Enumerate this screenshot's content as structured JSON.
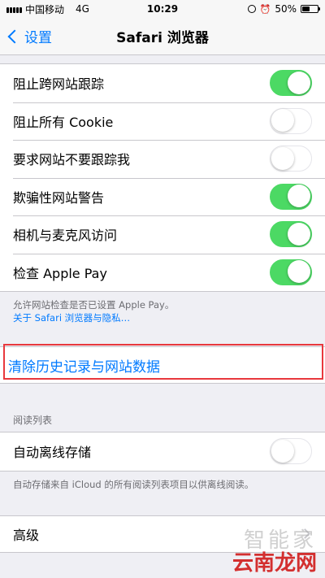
{
  "status_bar": {
    "carrier": "中国移动",
    "network": "4G",
    "time": "10:29",
    "battery_percent_label": "50%",
    "battery_level": 0.5
  },
  "nav": {
    "back_label": "设置",
    "title": "Safari 浏览器"
  },
  "privacy": {
    "rows": [
      {
        "label": "阻止跨网站跟踪",
        "on": true
      },
      {
        "label": "阻止所有 Cookie",
        "on": false
      },
      {
        "label": "要求网站不要跟踪我",
        "on": false
      },
      {
        "label": "欺骗性网站警告",
        "on": true
      },
      {
        "label": "相机与麦克风访问",
        "on": true
      },
      {
        "label": "检查 Apple Pay",
        "on": true
      }
    ],
    "footer_text": "允许网站检查是否已设置 Apple Pay。",
    "footer_link": "关于 Safari 浏览器与隐私…"
  },
  "clear_history": {
    "label": "清除历史记录与网站数据"
  },
  "reading_list": {
    "header": "阅读列表",
    "row": {
      "label": "自动离线存储",
      "on": false
    },
    "footer_text": "自动存储来自 iCloud 的所有阅读列表项目以供离线阅读。"
  },
  "advanced": {
    "label": "高级"
  },
  "watermark": {
    "top": "智能家",
    "bottom": "云南龙网"
  },
  "colors": {
    "accent": "#007aff",
    "toggle_on": "#4cd964",
    "highlight": "#e8383d"
  }
}
